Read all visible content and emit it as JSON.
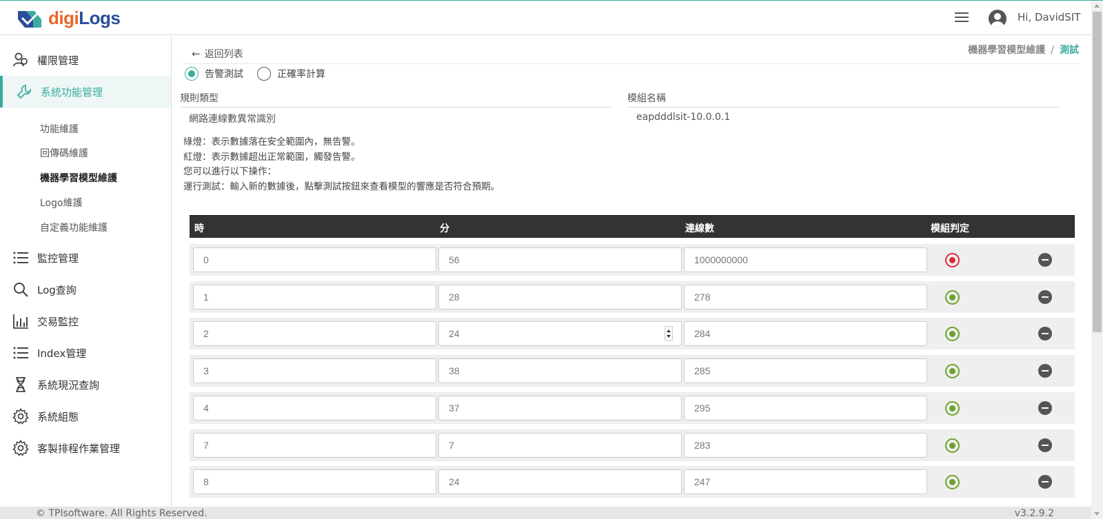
{
  "header": {
    "logo_part1": "digi",
    "logo_part2": "Logs",
    "user_greeting": "Hi, DavidSIT"
  },
  "sidebar": {
    "items": [
      {
        "label": "權限管理",
        "icon": "users-icon"
      },
      {
        "label": "系統功能管理",
        "icon": "wrench-icon"
      },
      {
        "label": "監控管理",
        "icon": "list-icon"
      },
      {
        "label": "Log查詢",
        "icon": "search-icon"
      },
      {
        "label": "交易監控",
        "icon": "bar-chart-icon"
      },
      {
        "label": "Index管理",
        "icon": "list-icon"
      },
      {
        "label": "系統現況查詢",
        "icon": "hourglass-icon"
      },
      {
        "label": "系統組態",
        "icon": "gear-icon"
      },
      {
        "label": "客製排程作業管理",
        "icon": "gear-icon"
      }
    ],
    "subitems": [
      "功能維護",
      "回傳碼維護",
      "機器學習模型維護",
      "Logo維護",
      "自定義功能維護"
    ]
  },
  "main": {
    "back_label": "返回列表",
    "breadcrumb": {
      "parent": "機器學習模型維護",
      "separator": "/",
      "current": "測試"
    },
    "radios": [
      {
        "label": "告警測試",
        "checked": true
      },
      {
        "label": "正確率計算",
        "checked": false
      }
    ],
    "rule_type_label": "規則類型",
    "rule_type_value": "網路連線數異常識別",
    "module_name_label": "模組名稱",
    "module_name_value": "eapdddlsit-10.0.0.1",
    "description": [
      "綠燈：表示數據落在安全範圍內，無告警。",
      "紅燈：表示數據超出正常範圍，觸發告警。",
      "您可以進行以下操作：",
      "運行測試：輸入新的數據後，點擊測試按鈕來查看模型的響應是否符合預期。"
    ],
    "table": {
      "headers": [
        "時",
        "分",
        "連線數",
        "模組判定"
      ],
      "rows": [
        {
          "hour": "0",
          "minute": "56",
          "connections": "1000000000",
          "status": "alert"
        },
        {
          "hour": "1",
          "minute": "28",
          "connections": "278",
          "status": "ok"
        },
        {
          "hour": "2",
          "minute": "24",
          "connections": "284",
          "status": "ok"
        },
        {
          "hour": "3",
          "minute": "38",
          "connections": "285",
          "status": "ok"
        },
        {
          "hour": "4",
          "minute": "37",
          "connections": "295",
          "status": "ok"
        },
        {
          "hour": "7",
          "minute": "7",
          "connections": "283",
          "status": "ok"
        },
        {
          "hour": "8",
          "minute": "24",
          "connections": "247",
          "status": "ok"
        }
      ]
    }
  },
  "footer": {
    "copyright": "© TPIsoftware. All Rights Reserved.",
    "version": "v3.2.9.2"
  },
  "colors": {
    "accent": "#3aaca0",
    "ok": "#6aa22a",
    "alert": "#dd2a3a",
    "logo_orange": "#e8672a",
    "logo_blue": "#2a4d9b"
  }
}
